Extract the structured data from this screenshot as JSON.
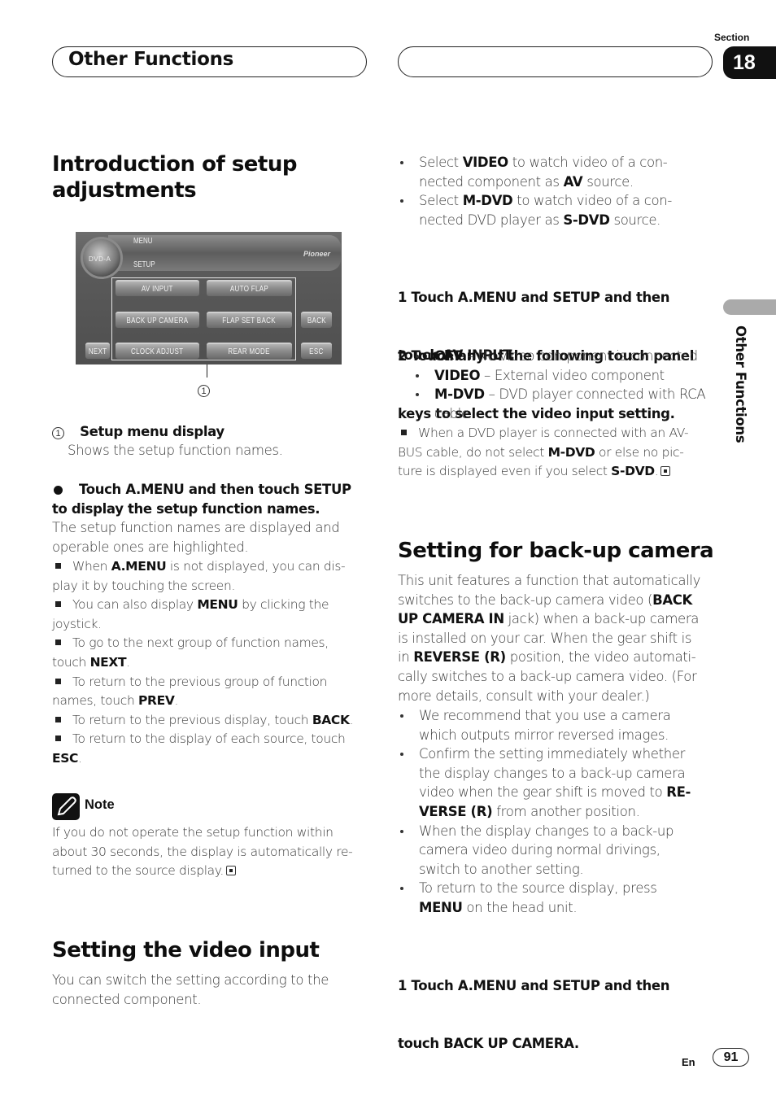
{
  "header": {
    "chapter_title": "Other Functions",
    "section_label": "Section",
    "section_number": "18"
  },
  "side_tab": {
    "label": "Other Functions"
  },
  "left": {
    "intro": {
      "title_line1": "Introduction of setup",
      "title_line2": "adjustments",
      "screen": {
        "logo_text": "DVD-A",
        "menu_label": "MENU",
        "setup_label": "SETUP",
        "brand": "Pioneer",
        "buttons": {
          "av_input": "AV INPUT",
          "auto_flap": "AUTO FLAP",
          "back_up_camera": "BACK UP CAMERA",
          "flap_set_back": "FLAP SET BACK",
          "clock_adjust": "CLOCK ADJUST",
          "rear_mode": "REAR MODE",
          "back": "BACK",
          "next": "NEXT",
          "esc": "ESC"
        }
      },
      "callout_number": "1",
      "callout_title": "Setup menu display",
      "callout_desc": "Shows the setup function names.",
      "step_line1": "Touch A.MENU and then touch SETUP",
      "step_line2": "to display the setup function names.",
      "step_desc_line1": "The setup function names are displayed and",
      "step_desc_line2": "operable ones are highlighted.",
      "notes": [
        {
          "pre": "When ",
          "b": "A.MENU",
          "post": " is not displayed, you can dis-",
          "line2": "play it by touching the screen."
        },
        {
          "pre": "You can also display ",
          "b": "MENU",
          "post": " by clicking the",
          "line2": "joystick."
        },
        {
          "pre": "To go to the next group of function names,",
          "line2_pre": "touch ",
          "line2_b": "NEXT",
          "line2_post": "."
        },
        {
          "pre": "To return to the previous group of function",
          "line2_pre": "names, touch ",
          "line2_b": "PREV",
          "line2_post": "."
        },
        {
          "pre": "To return to the previous display, touch ",
          "b": "BACK",
          "post": "."
        },
        {
          "pre": "To return to the display of each source, touch",
          "line2_b": "ESC",
          "line2_post": "."
        }
      ]
    },
    "note": {
      "label": "Note",
      "line1": "If you do not operate the setup function within",
      "line2": "about 30 seconds, the display is automatically re-",
      "line3": "turned to the source display."
    },
    "video_input": {
      "title": "Setting the video input",
      "line1": "You can switch the setting according to the",
      "line2": "connected component."
    }
  },
  "right": {
    "select_bullets": [
      {
        "pre": "Select ",
        "b": "VIDEO",
        "post": " to watch video of a con-",
        "line2_pre": "nected component as ",
        "line2_b": "AV",
        "line2_post": " source."
      },
      {
        "pre": "Select ",
        "b": "M-DVD",
        "post": " to watch video of a con-",
        "line2_pre": "nected DVD player as ",
        "line2_b": "S-DVD",
        "line2_post": " source."
      }
    ],
    "step1": {
      "line1": "1    Touch A.MENU and SETUP and then",
      "line2": "touch AV INPUT."
    },
    "step2": {
      "line1": "2    Touch any of the following touch panel",
      "line2": "keys to select the video input setting.",
      "options": [
        {
          "b": "OFF",
          "post": " – No video component is connected"
        },
        {
          "b": "VIDEO",
          "post": " – External video component"
        },
        {
          "b": "M-DVD",
          "post": " – DVD player connected with RCA",
          "line2": "cable"
        }
      ]
    },
    "dvd_note": {
      "line1": "When a DVD player is connected with an AV-",
      "line2_pre": "BUS cable, do not select ",
      "line2_b": "M-DVD",
      "line2_post": " or else no pic-",
      "line3_pre": "ture is displayed even if you select ",
      "line3_b": "S-DVD",
      "line3_post": "."
    },
    "backup": {
      "title": "Setting for back-up camera",
      "p_line1": "This unit features a function that automatically",
      "p_line2_pre": "switches to the back-up camera video (",
      "p_line2_b": "BACK",
      "p_line3_b": "UP CAMERA IN",
      "p_line3_post": " jack) when a back-up camera",
      "p_line4": "is installed on your car. When the gear shift is",
      "p_line5_pre": "in ",
      "p_line5_b": "REVERSE (R)",
      "p_line5_post": " position, the video automati-",
      "p_line6": "cally switches to a back-up camera video. (For",
      "p_line7": "more details, consult with your dealer.)",
      "bullets": {
        "b1_l1": "We recommend that you use a camera",
        "b1_l2": "which outputs mirror reversed images.",
        "b2_l1": "Confirm the setting immediately whether",
        "b2_l2": "the display changes to a back-up camera",
        "b2_l3_pre": "video when the gear shift is moved to ",
        "b2_l3_b": "RE-",
        "b2_l4_b": "VERSE (R)",
        "b2_l4_post": " from another position.",
        "b3_l1": "When the display changes to a back-up",
        "b3_l2": "camera video during normal drivings,",
        "b3_l3": "switch to another setting.",
        "b4_l1": "To return to the source display, press",
        "b4_l2_b": "MENU",
        "b4_l2_post": " on the head unit."
      },
      "step1_line1": "1    Touch A.MENU and SETUP and then",
      "step1_line2": "touch BACK UP CAMERA."
    }
  },
  "footer": {
    "lang": "En",
    "page": "91"
  }
}
